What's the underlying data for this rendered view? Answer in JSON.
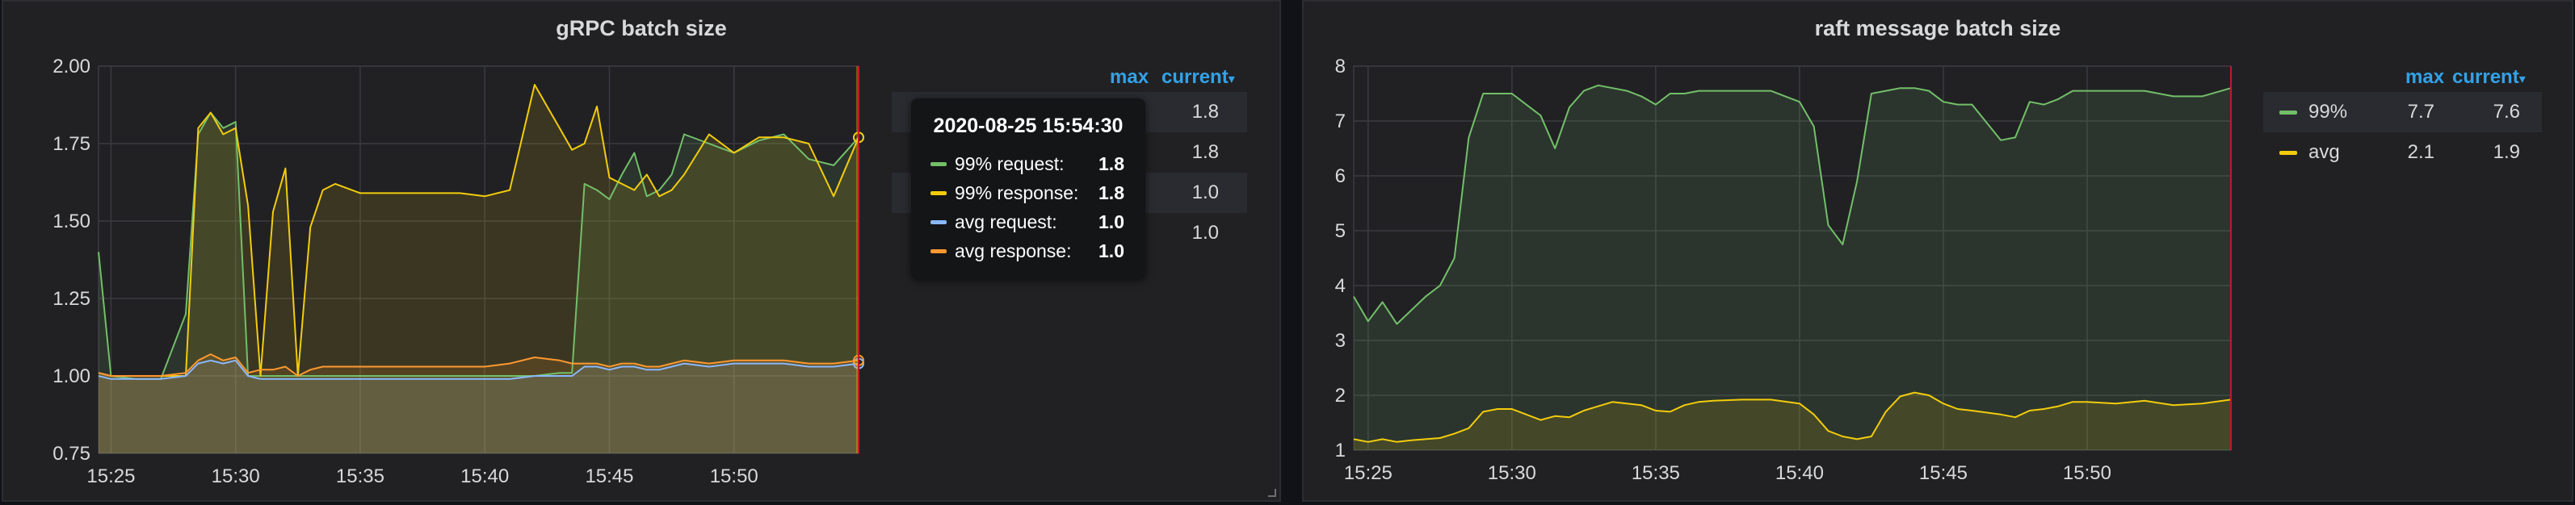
{
  "panels": [
    {
      "title": "gRPC batch size",
      "legend": {
        "max_label": "max",
        "current_label": "current",
        "rows": [
          {
            "max": "",
            "current": "1.8"
          },
          {
            "max": "",
            "current": "1.8"
          },
          {
            "max": "",
            "current": "1.0"
          },
          {
            "max": "",
            "current": "1.0"
          }
        ]
      },
      "tooltip": {
        "title": "2020-08-25 15:54:30",
        "rows": [
          {
            "name": "99% request:",
            "value": "1.8",
            "color": "#73bf69"
          },
          {
            "name": "99% response:",
            "value": "1.8",
            "color": "#f2cc0c"
          },
          {
            "name": "avg request:",
            "value": "1.0",
            "color": "#8ab8ff"
          },
          {
            "name": "avg response:",
            "value": "1.0",
            "color": "#ff9830"
          }
        ]
      }
    },
    {
      "title": "raft message batch size",
      "legend": {
        "max_label": "max",
        "current_label": "current",
        "rows": [
          {
            "name": "99%",
            "max": "7.7",
            "current": "7.6",
            "color": "#73bf69"
          },
          {
            "name": "avg",
            "max": "2.1",
            "current": "1.9",
            "color": "#f2cc0c"
          }
        ]
      }
    }
  ],
  "chart_data": [
    {
      "type": "area",
      "title": "gRPC batch size",
      "x_ticks": [
        "15:25",
        "15:30",
        "15:35",
        "15:40",
        "15:45",
        "15:50"
      ],
      "y_ticks": [
        "0.75",
        "1.00",
        "1.25",
        "1.50",
        "1.75",
        "2.00"
      ],
      "x_range": [
        "15:24:30",
        "15:54:30"
      ],
      "ylim": [
        0.75,
        2.0
      ],
      "x_minutes": [
        -0.5,
        0,
        1,
        2,
        3,
        3.5,
        4,
        4.5,
        5,
        5.5,
        6,
        6.5,
        7,
        7.5,
        8,
        8.5,
        9,
        10,
        11,
        12,
        13,
        14,
        15,
        16,
        17,
        18,
        18.5,
        19,
        19.5,
        20,
        20.5,
        21,
        21.5,
        22,
        22.5,
        23,
        24,
        25,
        26,
        27,
        28,
        29,
        30
      ],
      "series": [
        {
          "name": "99% request",
          "color": "#73bf69",
          "values": [
            1.4,
            1.0,
            0.99,
            0.99,
            1.2,
            1.78,
            1.85,
            1.8,
            1.82,
            1.0,
            1.0,
            1.0,
            1.0,
            1.0,
            1.0,
            1.0,
            1.0,
            1.0,
            1.0,
            1.0,
            1.0,
            1.0,
            1.0,
            1.0,
            1.0,
            1.01,
            1.01,
            1.62,
            1.6,
            1.57,
            1.65,
            1.72,
            1.58,
            1.6,
            1.65,
            1.78,
            1.75,
            1.72,
            1.76,
            1.78,
            1.7,
            1.68,
            1.77
          ]
        },
        {
          "name": "99% response",
          "color": "#f2cc0c",
          "values": [
            1.01,
            1.0,
            1.0,
            1.0,
            1.0,
            1.8,
            1.85,
            1.78,
            1.8,
            1.55,
            1.0,
            1.53,
            1.67,
            1.0,
            1.48,
            1.6,
            1.62,
            1.59,
            1.59,
            1.59,
            1.59,
            1.59,
            1.58,
            1.6,
            1.94,
            1.8,
            1.73,
            1.75,
            1.87,
            1.64,
            1.62,
            1.6,
            1.65,
            1.58,
            1.6,
            1.65,
            1.78,
            1.72,
            1.77,
            1.77,
            1.75,
            1.58,
            1.77
          ]
        },
        {
          "name": "avg request",
          "color": "#8ab8ff",
          "values": [
            1.0,
            0.99,
            0.99,
            0.99,
            1.0,
            1.04,
            1.05,
            1.04,
            1.05,
            1.0,
            0.99,
            0.99,
            0.99,
            0.99,
            0.99,
            0.99,
            0.99,
            0.99,
            0.99,
            0.99,
            0.99,
            0.99,
            0.99,
            0.99,
            1.0,
            1.0,
            1.0,
            1.03,
            1.03,
            1.02,
            1.03,
            1.03,
            1.02,
            1.02,
            1.03,
            1.04,
            1.03,
            1.04,
            1.04,
            1.04,
            1.03,
            1.03,
            1.04
          ]
        },
        {
          "name": "avg response",
          "color": "#ff9830",
          "values": [
            1.01,
            1.0,
            1.0,
            1.0,
            1.01,
            1.05,
            1.07,
            1.05,
            1.06,
            1.01,
            1.02,
            1.02,
            1.03,
            1.0,
            1.02,
            1.03,
            1.03,
            1.03,
            1.03,
            1.03,
            1.03,
            1.03,
            1.03,
            1.04,
            1.06,
            1.05,
            1.04,
            1.04,
            1.04,
            1.03,
            1.04,
            1.04,
            1.03,
            1.03,
            1.04,
            1.05,
            1.04,
            1.05,
            1.05,
            1.05,
            1.04,
            1.04,
            1.05
          ]
        }
      ],
      "grid": true,
      "legend_position": "right"
    },
    {
      "type": "area",
      "title": "raft message batch size",
      "x_ticks": [
        "15:25",
        "15:30",
        "15:35",
        "15:40",
        "15:45",
        "15:50"
      ],
      "y_ticks": [
        "1",
        "2",
        "3",
        "4",
        "5",
        "6",
        "7",
        "8"
      ],
      "x_range": [
        "15:24:30",
        "15:54:30"
      ],
      "ylim": [
        1,
        8
      ],
      "x_minutes": [
        -0.5,
        0,
        0.5,
        1,
        1.5,
        2,
        2.5,
        3,
        3.5,
        4,
        4.5,
        5,
        6,
        6.5,
        7,
        7.5,
        8,
        8.5,
        9,
        9.5,
        10,
        10.5,
        11,
        11.5,
        12,
        13,
        14,
        15,
        15.5,
        16,
        16.5,
        17,
        17.5,
        18,
        18.5,
        19,
        19.5,
        20,
        20.5,
        21,
        22,
        22.5,
        23,
        23.5,
        24,
        24.5,
        25,
        26,
        27,
        28,
        29,
        30
      ],
      "series": [
        {
          "name": "99%",
          "color": "#73bf69",
          "values": [
            3.8,
            3.35,
            3.7,
            3.3,
            3.55,
            3.8,
            4.0,
            4.5,
            6.7,
            7.5,
            7.5,
            7.5,
            7.1,
            6.5,
            7.25,
            7.55,
            7.65,
            7.6,
            7.55,
            7.45,
            7.3,
            7.5,
            7.5,
            7.55,
            7.55,
            7.55,
            7.55,
            7.35,
            6.9,
            5.1,
            4.75,
            5.9,
            7.5,
            7.55,
            7.6,
            7.6,
            7.55,
            7.35,
            7.3,
            7.3,
            6.65,
            6.7,
            7.35,
            7.3,
            7.4,
            7.55,
            7.55,
            7.55,
            7.55,
            7.45,
            7.45,
            7.6
          ]
        },
        {
          "name": "avg",
          "color": "#f2cc0c",
          "values": [
            1.2,
            1.15,
            1.2,
            1.15,
            1.18,
            1.2,
            1.22,
            1.3,
            1.4,
            1.7,
            1.75,
            1.75,
            1.55,
            1.62,
            1.6,
            1.72,
            1.8,
            1.88,
            1.85,
            1.82,
            1.72,
            1.7,
            1.82,
            1.88,
            1.9,
            1.92,
            1.92,
            1.85,
            1.65,
            1.35,
            1.25,
            1.2,
            1.25,
            1.7,
            1.98,
            2.05,
            2.0,
            1.85,
            1.75,
            1.72,
            1.65,
            1.6,
            1.72,
            1.75,
            1.8,
            1.88,
            1.88,
            1.85,
            1.9,
            1.82,
            1.85,
            1.92
          ]
        }
      ],
      "grid": true,
      "legend_position": "right"
    }
  ]
}
